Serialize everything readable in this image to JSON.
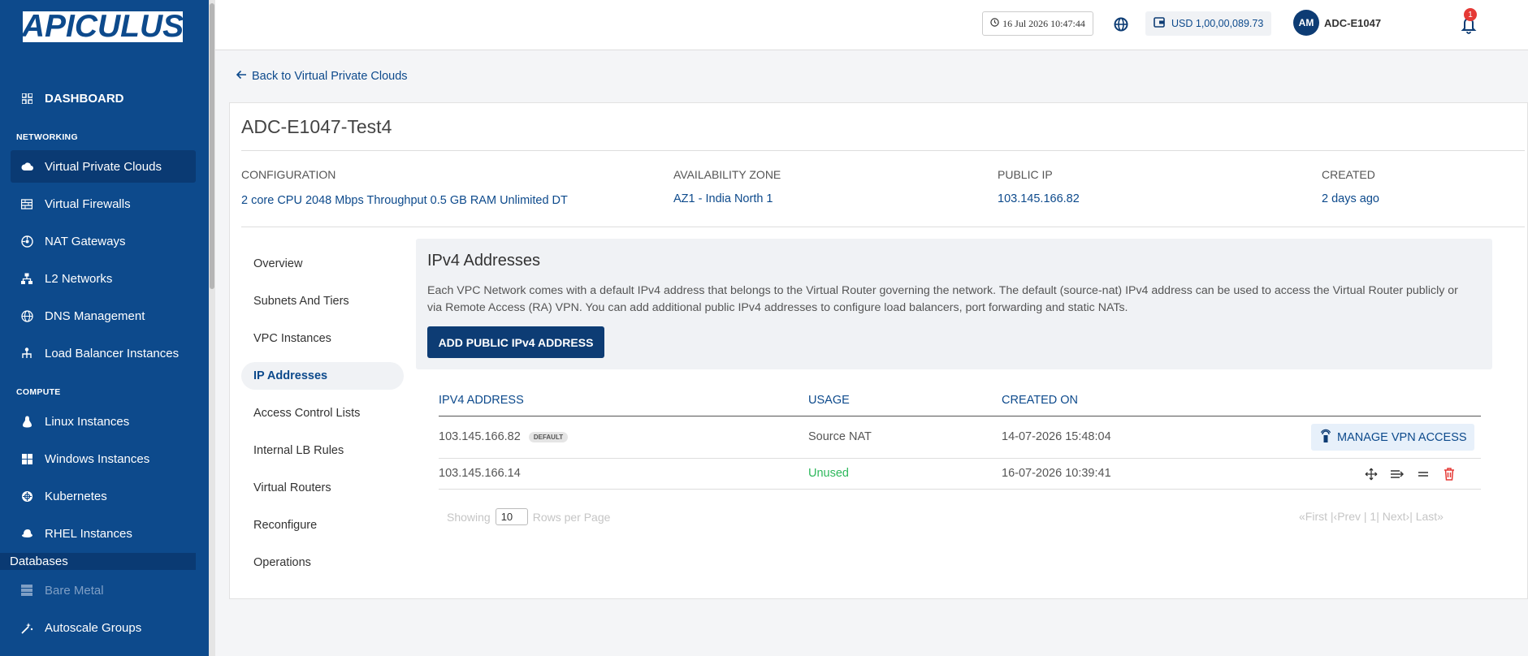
{
  "sidebar": {
    "logo": "APICULUS",
    "dashboard": "DASHBOARD",
    "sections": {
      "networking": "NETWORKING",
      "compute": "COMPUTE",
      "databases": "Databases"
    },
    "items": {
      "vpc": "Virtual Private Clouds",
      "firewalls": "Virtual Firewalls",
      "nat": "NAT Gateways",
      "l2": "L2 Networks",
      "dns": "DNS Management",
      "lb": "Load Balancer Instances",
      "linux": "Linux Instances",
      "windows": "Windows Instances",
      "kubernetes": "Kubernetes",
      "rhel": "RHEL Instances",
      "baremetal": "Bare Metal",
      "autoscale": "Autoscale Groups"
    }
  },
  "topbar": {
    "datetime": "16 Jul 2026 10:47:44",
    "balance": "USD 1,00,00,089.73",
    "avatar_initials": "AM",
    "username": "ADC-E1047",
    "notifications": "1"
  },
  "back_link": "Back to Virtual Private Clouds",
  "vpc": {
    "title": "ADC-E1047-Test4",
    "configuration_label": "CONFIGURATION",
    "configuration_value": "2 core CPU 2048 Mbps Throughput 0.5 GB RAM Unlimited DT",
    "zone_label": "AVAILABILITY ZONE",
    "zone_value": "AZ1 - India North 1",
    "ip_label": "PUBLIC IP",
    "ip_value": "103.145.166.82",
    "created_label": "CREATED",
    "created_value": "2 days ago"
  },
  "tabs": {
    "overview": "Overview",
    "subnets": "Subnets And Tiers",
    "instances": "VPC Instances",
    "ip": "IP Addresses",
    "acl": "Access Control Lists",
    "internal_lb": "Internal LB Rules",
    "routers": "Virtual Routers",
    "reconfigure": "Reconfigure",
    "operations": "Operations"
  },
  "ipv4": {
    "title": "IPv4 Addresses",
    "description": "Each VPC Network comes with a default IPv4 address that belongs to the Virtual Router governing the network. The default (source-nat) IPv4 address can be used to access the Virtual Router publicly or via Remote Access (RA) VPN. You can add additional public IPv4 addresses to configure load balancers, port forwarding and static NATs.",
    "add_button": "ADD PUBLIC IPv4 ADDRESS"
  },
  "table": {
    "headers": {
      "address": "IPV4 ADDRESS",
      "usage": "USAGE",
      "created": "CREATED ON"
    },
    "rows": [
      {
        "address": "103.145.166.82",
        "badge": "DEFAULT",
        "usage": "Source NAT",
        "created": "14-07-2026 15:48:04",
        "action": "MANAGE VPN ACCESS"
      },
      {
        "address": "103.145.166.14",
        "usage": "Unused",
        "created": "16-07-2026 10:39:41"
      }
    ]
  },
  "pagination": {
    "showing": "Showing",
    "rows_value": "10",
    "rows_per_page": "Rows per Page",
    "first": "«First",
    "sep1": "|",
    "prev": "‹Prev",
    "sep2": "|",
    "page": "1",
    "sep3": "|",
    "next": "Next›",
    "sep4": "|",
    "last": "Last»"
  },
  "colors": {
    "brand": "#0d4a8c",
    "success": "#2eb85c",
    "danger": "#e53935"
  }
}
